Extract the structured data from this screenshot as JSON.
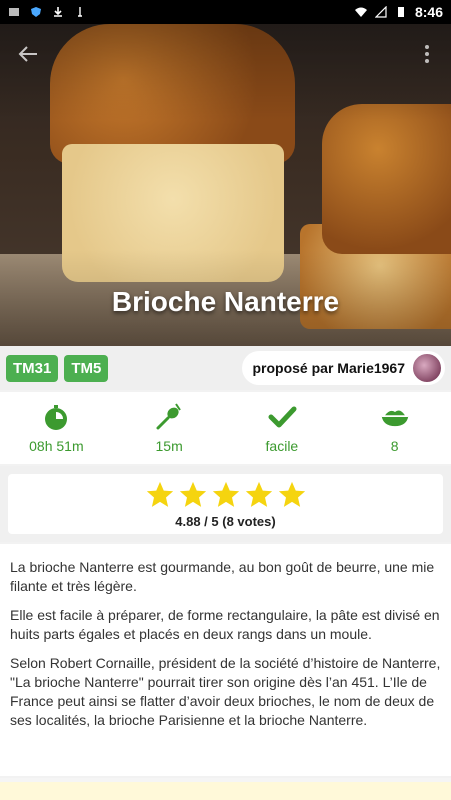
{
  "status_bar": {
    "time": "8:46",
    "icons": [
      "notification-icon",
      "shield-icon",
      "download-icon",
      "usb-icon",
      "wifi-icon",
      "signal-icon",
      "battery-icon"
    ]
  },
  "hero": {
    "title": "Brioche Nanterre",
    "back_icon": "arrow-left-icon",
    "more_icon": "more-vertical-icon"
  },
  "tags": [
    "TM31",
    "TM5"
  ],
  "author": {
    "label": "proposé par Marie1967"
  },
  "info": [
    {
      "icon": "timer-icon",
      "label": "08h 51m"
    },
    {
      "icon": "spatula-icon",
      "label": "15m"
    },
    {
      "icon": "check-icon",
      "label": "facile"
    },
    {
      "icon": "bowl-icon",
      "label": "8"
    }
  ],
  "rating": {
    "stars_filled": 5,
    "stars_total": 5,
    "text": "4.88 / 5 (8 votes)"
  },
  "description": {
    "p1": "La brioche Nanterre est gourmande, au bon goût de beurre, une mie filante et très légère.",
    "p2": "Elle est facile à préparer, de forme rectangulaire, la pâte est divisé en huits parts égales et placés en deux rangs dans un moule.",
    "p3": "Selon Robert Cornaille, président de la société d’histoire de Nanterre, \"La brioche Nanterre\" pourrait tirer son origine dès l’an 451. L’Ile de France peut ainsi se flatter d’avoir deux brioches, le nom de deux de ses localités, la brioche Parisienne et la brioche Nanterre."
  },
  "colors": {
    "accent": "#4caf50",
    "star": "#f5d40f",
    "icon_green": "#3c9a2f"
  }
}
